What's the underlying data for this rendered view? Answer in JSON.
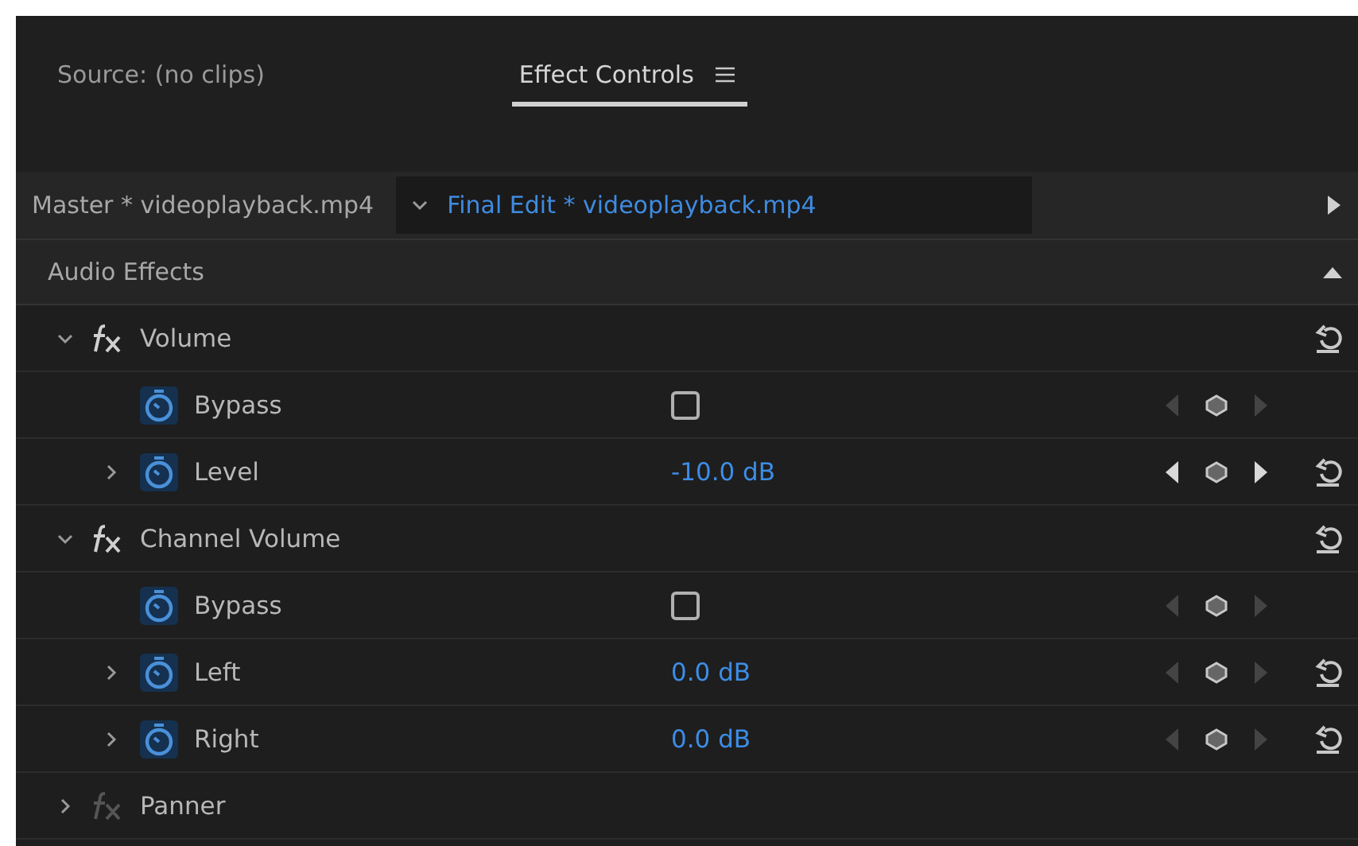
{
  "tabs": [
    {
      "label": "Source: (no clips)",
      "selected": false,
      "menu": false
    },
    {
      "label": "Effect Controls",
      "selected": true,
      "menu": true
    }
  ],
  "clip_bar": {
    "master": "Master * videoplayback.mp4",
    "sequence": "Final Edit * videoplayback.mp4"
  },
  "section": {
    "title": "Audio Effects",
    "expanded": true
  },
  "effects": [
    {
      "name": "Volume",
      "expanded": true,
      "enabled": true,
      "reset": true,
      "params": [
        {
          "kind": "checkbox",
          "name": "Bypass",
          "checked": false,
          "nav_active": false,
          "reset": false
        },
        {
          "kind": "value",
          "name": "Level",
          "value": "-10.0 dB",
          "expanded": false,
          "nav_active": true,
          "reset": true
        }
      ]
    },
    {
      "name": "Channel Volume",
      "expanded": true,
      "enabled": true,
      "reset": true,
      "params": [
        {
          "kind": "checkbox",
          "name": "Bypass",
          "checked": false,
          "nav_active": false,
          "reset": false
        },
        {
          "kind": "value",
          "name": "Left",
          "value": "0.0 dB",
          "expanded": false,
          "nav_active": false,
          "reset": true
        },
        {
          "kind": "value",
          "name": "Right",
          "value": "0.0 dB",
          "expanded": false,
          "nav_active": false,
          "reset": true
        }
      ]
    },
    {
      "name": "Panner",
      "expanded": false,
      "enabled": false,
      "reset": false
    }
  ]
}
